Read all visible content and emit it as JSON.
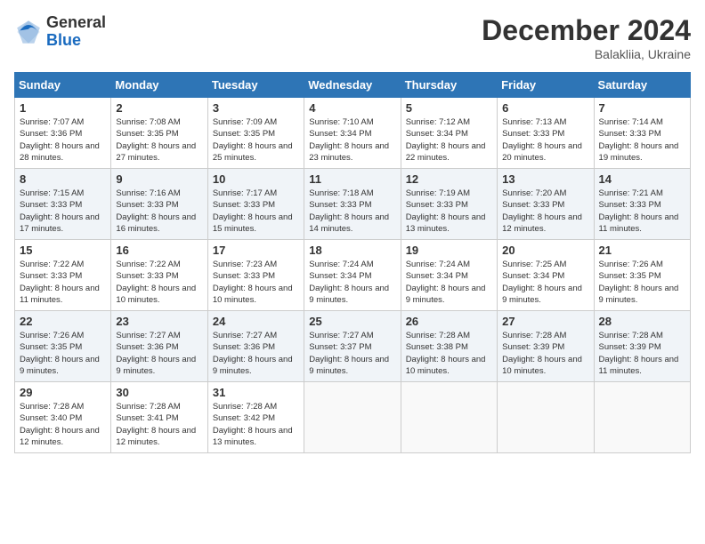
{
  "header": {
    "title": "December 2024",
    "location": "Balakliia, Ukraine"
  },
  "logo": {
    "line1": "General",
    "line2": "Blue"
  },
  "weekdays": [
    "Sunday",
    "Monday",
    "Tuesday",
    "Wednesday",
    "Thursday",
    "Friday",
    "Saturday"
  ],
  "weeks": [
    [
      {
        "day": 1,
        "sunrise": "7:07 AM",
        "sunset": "3:36 PM",
        "daylight": "8 hours and 28 minutes."
      },
      {
        "day": 2,
        "sunrise": "7:08 AM",
        "sunset": "3:35 PM",
        "daylight": "8 hours and 27 minutes."
      },
      {
        "day": 3,
        "sunrise": "7:09 AM",
        "sunset": "3:35 PM",
        "daylight": "8 hours and 25 minutes."
      },
      {
        "day": 4,
        "sunrise": "7:10 AM",
        "sunset": "3:34 PM",
        "daylight": "8 hours and 23 minutes."
      },
      {
        "day": 5,
        "sunrise": "7:12 AM",
        "sunset": "3:34 PM",
        "daylight": "8 hours and 22 minutes."
      },
      {
        "day": 6,
        "sunrise": "7:13 AM",
        "sunset": "3:33 PM",
        "daylight": "8 hours and 20 minutes."
      },
      {
        "day": 7,
        "sunrise": "7:14 AM",
        "sunset": "3:33 PM",
        "daylight": "8 hours and 19 minutes."
      }
    ],
    [
      {
        "day": 8,
        "sunrise": "7:15 AM",
        "sunset": "3:33 PM",
        "daylight": "8 hours and 17 minutes."
      },
      {
        "day": 9,
        "sunrise": "7:16 AM",
        "sunset": "3:33 PM",
        "daylight": "8 hours and 16 minutes."
      },
      {
        "day": 10,
        "sunrise": "7:17 AM",
        "sunset": "3:33 PM",
        "daylight": "8 hours and 15 minutes."
      },
      {
        "day": 11,
        "sunrise": "7:18 AM",
        "sunset": "3:33 PM",
        "daylight": "8 hours and 14 minutes."
      },
      {
        "day": 12,
        "sunrise": "7:19 AM",
        "sunset": "3:33 PM",
        "daylight": "8 hours and 13 minutes."
      },
      {
        "day": 13,
        "sunrise": "7:20 AM",
        "sunset": "3:33 PM",
        "daylight": "8 hours and 12 minutes."
      },
      {
        "day": 14,
        "sunrise": "7:21 AM",
        "sunset": "3:33 PM",
        "daylight": "8 hours and 11 minutes."
      }
    ],
    [
      {
        "day": 15,
        "sunrise": "7:22 AM",
        "sunset": "3:33 PM",
        "daylight": "8 hours and 11 minutes."
      },
      {
        "day": 16,
        "sunrise": "7:22 AM",
        "sunset": "3:33 PM",
        "daylight": "8 hours and 10 minutes."
      },
      {
        "day": 17,
        "sunrise": "7:23 AM",
        "sunset": "3:33 PM",
        "daylight": "8 hours and 10 minutes."
      },
      {
        "day": 18,
        "sunrise": "7:24 AM",
        "sunset": "3:34 PM",
        "daylight": "8 hours and 9 minutes."
      },
      {
        "day": 19,
        "sunrise": "7:24 AM",
        "sunset": "3:34 PM",
        "daylight": "8 hours and 9 minutes."
      },
      {
        "day": 20,
        "sunrise": "7:25 AM",
        "sunset": "3:34 PM",
        "daylight": "8 hours and 9 minutes."
      },
      {
        "day": 21,
        "sunrise": "7:26 AM",
        "sunset": "3:35 PM",
        "daylight": "8 hours and 9 minutes."
      }
    ],
    [
      {
        "day": 22,
        "sunrise": "7:26 AM",
        "sunset": "3:35 PM",
        "daylight": "8 hours and 9 minutes."
      },
      {
        "day": 23,
        "sunrise": "7:27 AM",
        "sunset": "3:36 PM",
        "daylight": "8 hours and 9 minutes."
      },
      {
        "day": 24,
        "sunrise": "7:27 AM",
        "sunset": "3:36 PM",
        "daylight": "8 hours and 9 minutes."
      },
      {
        "day": 25,
        "sunrise": "7:27 AM",
        "sunset": "3:37 PM",
        "daylight": "8 hours and 9 minutes."
      },
      {
        "day": 26,
        "sunrise": "7:28 AM",
        "sunset": "3:38 PM",
        "daylight": "8 hours and 10 minutes."
      },
      {
        "day": 27,
        "sunrise": "7:28 AM",
        "sunset": "3:39 PM",
        "daylight": "8 hours and 10 minutes."
      },
      {
        "day": 28,
        "sunrise": "7:28 AM",
        "sunset": "3:39 PM",
        "daylight": "8 hours and 11 minutes."
      }
    ],
    [
      {
        "day": 29,
        "sunrise": "7:28 AM",
        "sunset": "3:40 PM",
        "daylight": "8 hours and 12 minutes."
      },
      {
        "day": 30,
        "sunrise": "7:28 AM",
        "sunset": "3:41 PM",
        "daylight": "8 hours and 12 minutes."
      },
      {
        "day": 31,
        "sunrise": "7:28 AM",
        "sunset": "3:42 PM",
        "daylight": "8 hours and 13 minutes."
      },
      null,
      null,
      null,
      null
    ]
  ]
}
